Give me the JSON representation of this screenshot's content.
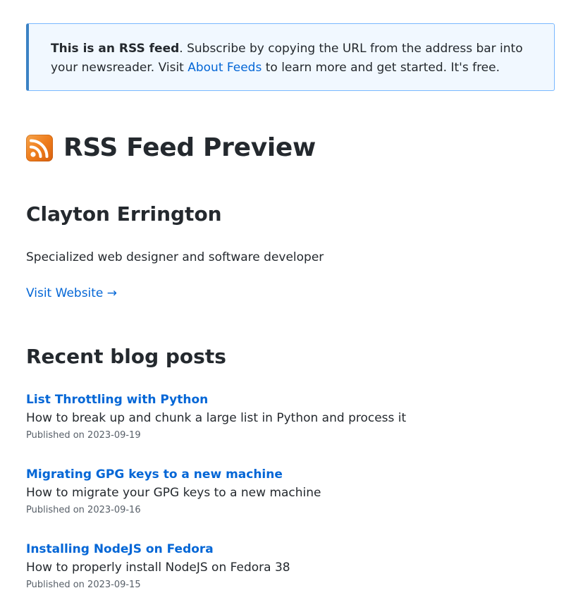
{
  "notice": {
    "strong": "This is an RSS feed",
    "text_before_link": ". Subscribe by copying the URL from the address bar into your newsreader. Visit ",
    "link_label": "About Feeds",
    "text_after_link": " to learn more and get started. It's free."
  },
  "header": {
    "icon": "rss-icon",
    "title": "RSS Feed Preview"
  },
  "feed": {
    "author": "Clayton Errington",
    "description": "Specialized web designer and software developer",
    "visit_label": "Visit Website →"
  },
  "posts_section": {
    "title": "Recent blog posts",
    "date_prefix": "Published on ",
    "items": [
      {
        "title": "List Throttling with Python",
        "description": "How to break up and chunk a large list in Python and process it",
        "date": "2023-09-19"
      },
      {
        "title": "Migrating GPG keys to a new machine",
        "description": "How to migrate your GPG keys to a new machine",
        "date": "2023-09-16"
      },
      {
        "title": "Installing NodeJS on Fedora",
        "description": "How to properly install NodeJS on Fedora 38",
        "date": "2023-09-15"
      }
    ]
  },
  "colors": {
    "link": "#0366d6",
    "text": "#24292e",
    "muted": "#586069",
    "notice_bg": "#f1f8ff",
    "notice_border": "#3b82c4",
    "rss_orange": "#ee7d1d"
  }
}
